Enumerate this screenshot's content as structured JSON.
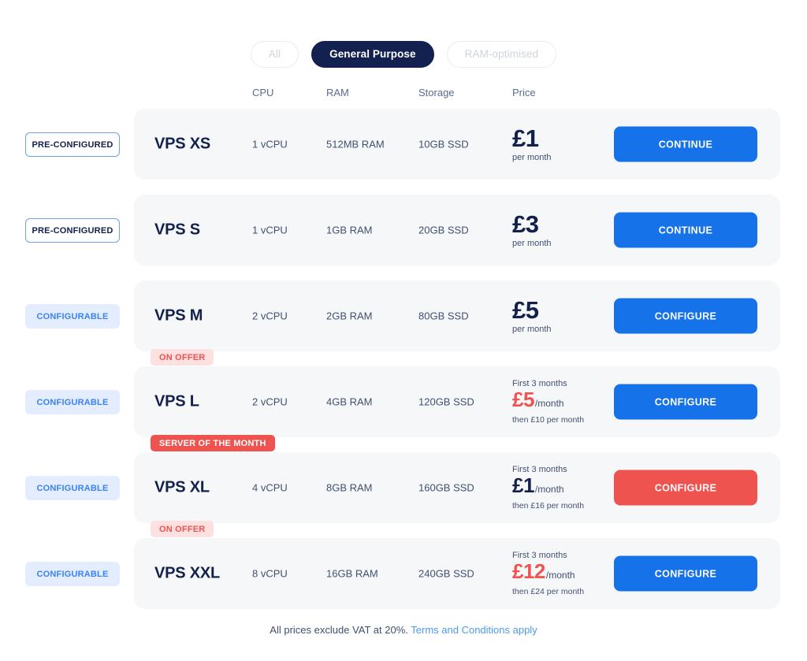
{
  "tabs": [
    {
      "label": "All",
      "active": false
    },
    {
      "label": "General Purpose",
      "active": true
    },
    {
      "label": "RAM-optimised",
      "active": false
    }
  ],
  "columns": {
    "cpu": "CPU",
    "ram": "RAM",
    "storage": "Storage",
    "price": "Price"
  },
  "colors": {
    "accent_blue": "#1572e8",
    "navy": "#122150",
    "offer_red": "#ef5350",
    "badge_pink": "#fde0e0",
    "configurable_bg": "#e3edfd",
    "card_bg": "#f6f7f9",
    "link_blue": "#4c9aee"
  },
  "plans": [
    {
      "side_label": "PRE-CONFIGURED",
      "side_type": "preconfigured",
      "badge": null,
      "name": "VPS XS",
      "cpu": "1 vCPU",
      "ram": "512MB RAM",
      "storage": "10GB SSD",
      "price_type": "simple",
      "amount": "£1",
      "per": "per month",
      "cta": "CONTINUE",
      "cta_style": "primary"
    },
    {
      "side_label": "PRE-CONFIGURED",
      "side_type": "preconfigured",
      "badge": null,
      "name": "VPS S",
      "cpu": "1 vCPU",
      "ram": "1GB RAM",
      "storage": "20GB SSD",
      "price_type": "simple",
      "amount": "£3",
      "per": "per month",
      "cta": "CONTINUE",
      "cta_style": "primary"
    },
    {
      "side_label": "CONFIGURABLE",
      "side_type": "configurable",
      "badge": null,
      "name": "VPS M",
      "cpu": "2 vCPU",
      "ram": "2GB RAM",
      "storage": "80GB SSD",
      "price_type": "simple",
      "amount": "£5",
      "per": "per month",
      "cta": "CONFIGURE",
      "cta_style": "primary"
    },
    {
      "side_label": "CONFIGURABLE",
      "side_type": "configurable",
      "badge": {
        "text": "ON OFFER",
        "style": "offer"
      },
      "name": "VPS L",
      "cpu": "2 vCPU",
      "ram": "4GB RAM",
      "storage": "120GB SSD",
      "price_type": "offer",
      "pre_note": "First 3 months",
      "amount": "£5",
      "per_month": "/month",
      "then_note": "then £10 per month",
      "amount_color": "red",
      "cta": "CONFIGURE",
      "cta_style": "primary"
    },
    {
      "side_label": "CONFIGURABLE",
      "side_type": "configurable",
      "badge": {
        "text": "SERVER OF THE MONTH",
        "style": "som"
      },
      "name": "VPS XL",
      "cpu": "4 vCPU",
      "ram": "8GB RAM",
      "storage": "160GB SSD",
      "price_type": "offer",
      "pre_note": "First 3 months",
      "amount": "£1",
      "per_month": "/month",
      "then_note": "then £16 per month",
      "amount_color": "navy",
      "cta": "CONFIGURE",
      "cta_style": "danger"
    },
    {
      "side_label": "CONFIGURABLE",
      "side_type": "configurable",
      "badge": {
        "text": "ON OFFER",
        "style": "offer"
      },
      "name": "VPS XXL",
      "cpu": "8 vCPU",
      "ram": "16GB RAM",
      "storage": "240GB SSD",
      "price_type": "offer",
      "pre_note": "First 3 months",
      "amount": "£12",
      "per_month": "/month",
      "then_note": "then £24 per month",
      "amount_color": "red",
      "cta": "CONFIGURE",
      "cta_style": "primary"
    }
  ],
  "footer": {
    "text": "All prices exclude VAT at 20%.",
    "link": "Terms and Conditions apply"
  }
}
